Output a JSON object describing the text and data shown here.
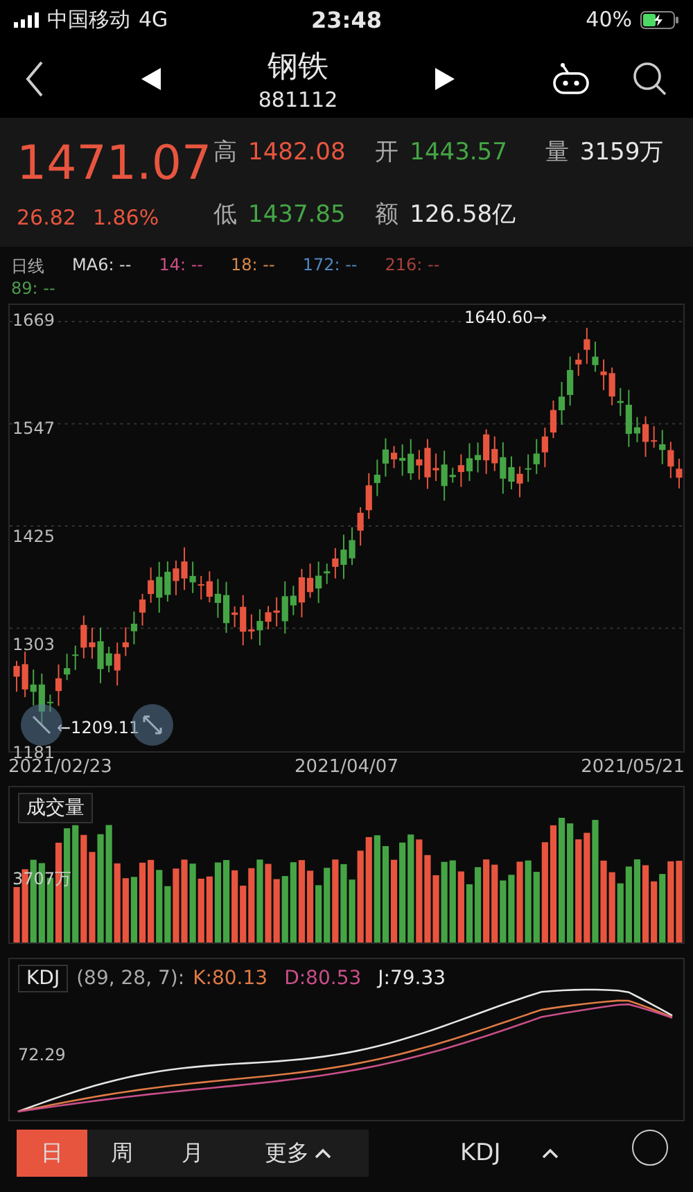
{
  "status_bar": {
    "carrier": "中国移动",
    "network": "4G",
    "time": "23:48",
    "battery": "40%"
  },
  "nav": {
    "title": "钢铁",
    "code": "881112"
  },
  "quote": {
    "price": "1471.07",
    "change": "26.82",
    "change_pct": "1.86%"
  },
  "stats": [
    {
      "label": "高",
      "value": "1482.08",
      "color": "#e8553f"
    },
    {
      "label": "开",
      "value": "1443.57",
      "color": "#45a545"
    },
    {
      "label": "量",
      "value": "3159万",
      "color": "#e6e6e6"
    },
    {
      "label": "低",
      "value": "1437.85",
      "color": "#45a545"
    },
    {
      "label": "额",
      "value": "126.58亿",
      "color": "#e6e6e6"
    }
  ],
  "ma_legend": {
    "period": "日线",
    "items": [
      {
        "label": "MA6: --",
        "color": "#d8d8d8"
      },
      {
        "label": "14: --",
        "color": "#cc4f86"
      },
      {
        "label": "18: --",
        "color": "#d9894a"
      },
      {
        "label": "172: --",
        "color": "#4f86c0"
      },
      {
        "label": "216: --",
        "color": "#a8403c"
      },
      {
        "label": "89: --",
        "color": "#4f9a50"
      }
    ]
  },
  "price_chart": {
    "y_labels": [
      "1669",
      "1547",
      "1425",
      "1303",
      "1181"
    ],
    "high_marker": "1640.60→",
    "low_marker": "←1209.11",
    "dates": [
      "2021/02/23",
      "2021/04/07",
      "2021/05/21"
    ]
  },
  "volume": {
    "title": "成交量",
    "reading": "3707万"
  },
  "kdj": {
    "title": "KDJ",
    "params": "(89, 28, 7):",
    "k": "K:80.13",
    "d": "D:80.53",
    "j": "J:79.33",
    "level_label": "72.29"
  },
  "bottom_tabs": [
    {
      "label": "日",
      "selected": true
    },
    {
      "label": "周",
      "selected": false
    },
    {
      "label": "月",
      "selected": false
    },
    {
      "label": "更多",
      "selected": false
    }
  ],
  "indicator": "KDJ"
}
